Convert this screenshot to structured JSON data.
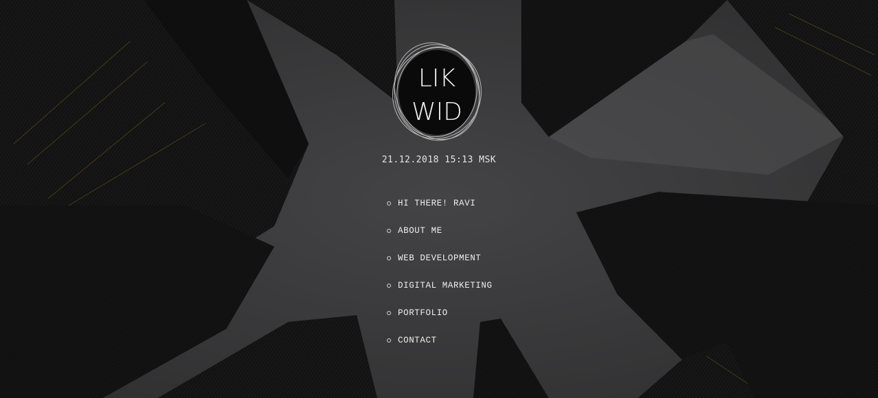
{
  "logo": {
    "line1": "LIK",
    "line2": "WID",
    "icon": "likwid-logo"
  },
  "datetime": "21.12.2018 15:13 MSK",
  "menu": {
    "items": [
      {
        "label": "HI THERE! RAVI"
      },
      {
        "label": "ABOUT ME"
      },
      {
        "label": "WEB DEVELOPMENT"
      },
      {
        "label": "DIGITAL MARKETING"
      },
      {
        "label": "PORTFOLIO"
      },
      {
        "label": "CONTACT"
      }
    ]
  },
  "colors": {
    "background": "#3a3a3b",
    "building": "#111112",
    "text": "#efefef",
    "accent_lights": "#6b5a1e"
  }
}
